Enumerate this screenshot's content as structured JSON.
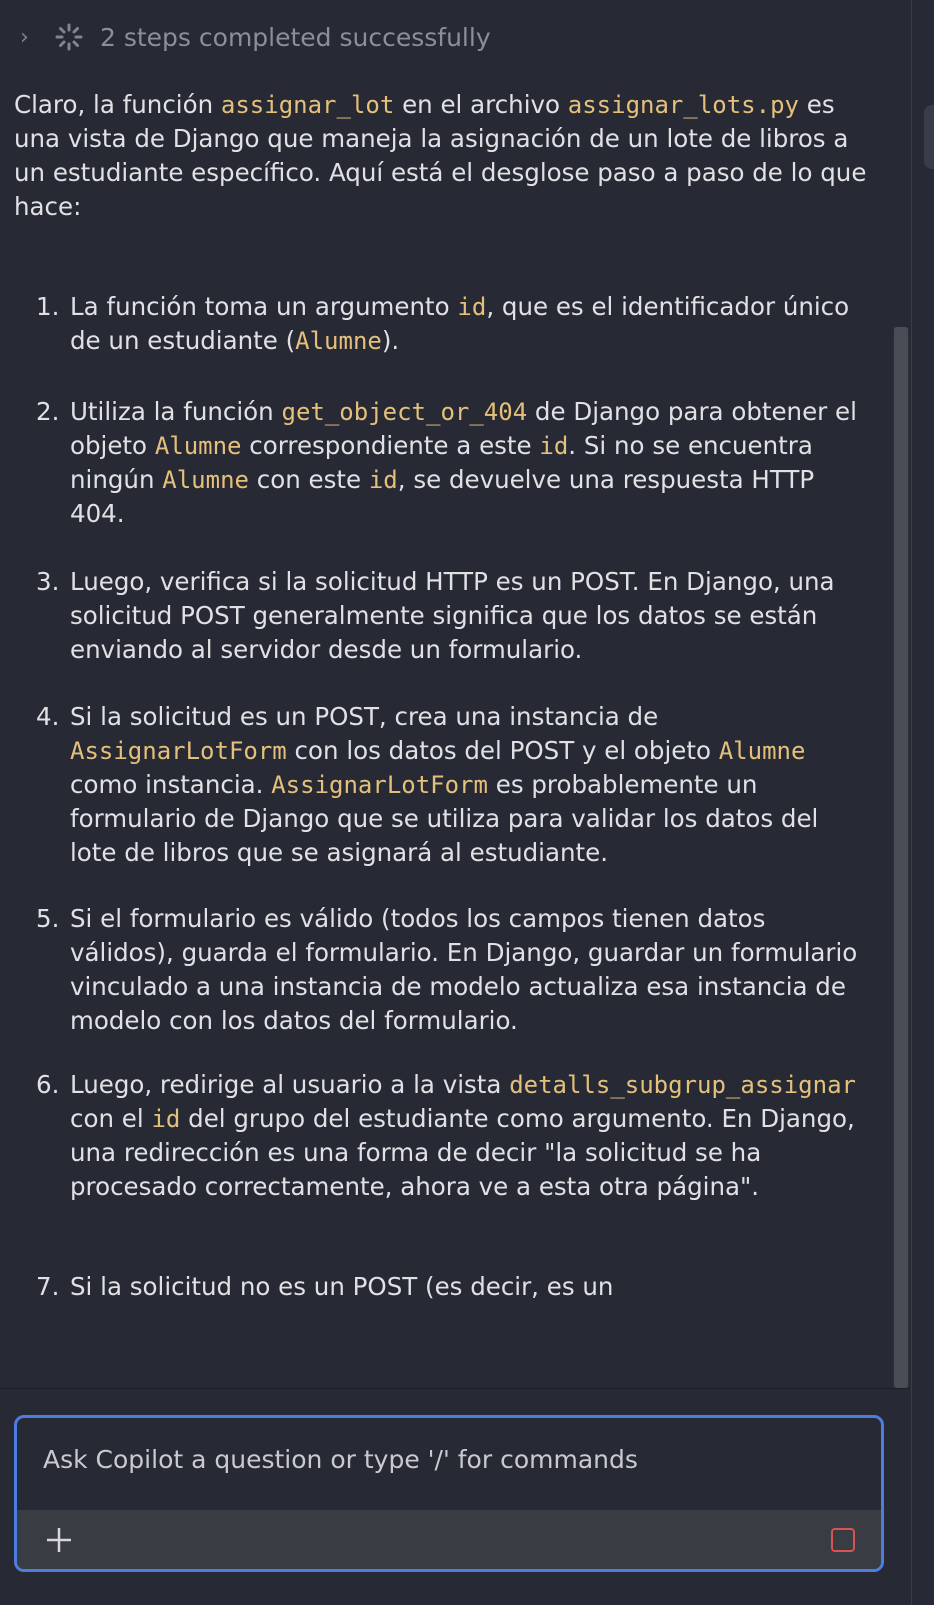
{
  "steps": {
    "summary": "2 steps completed successfully"
  },
  "intro": {
    "p1": "Claro, la función ",
    "c1": "assignar_lot",
    "p2": " en el archivo ",
    "c2": "assignar_lots.py",
    "p3": " es una vista de Django que maneja la asignación de un lote de libros a un estudiante específico. Aquí está el desglose paso a paso de lo que hace:"
  },
  "list": [
    {
      "num": "1.",
      "parts": [
        {
          "t": "La función toma un argumento "
        },
        {
          "c": "id"
        },
        {
          "t": ", que es el identificador único de un estudiante ("
        },
        {
          "c": "Alumne"
        },
        {
          "t": ")."
        }
      ]
    },
    {
      "num": "2.",
      "parts": [
        {
          "t": "Utiliza la función "
        },
        {
          "c": "get_object_or_404"
        },
        {
          "t": " de Django para obtener el objeto "
        },
        {
          "c": "Alumne"
        },
        {
          "t": " correspondiente a este "
        },
        {
          "c": "id"
        },
        {
          "t": ". Si no se encuentra ningún "
        },
        {
          "c": "Alumne"
        },
        {
          "t": " con este "
        },
        {
          "c": "id"
        },
        {
          "t": ", se devuelve una respuesta HTTP 404."
        }
      ]
    },
    {
      "num": "3.",
      "parts": [
        {
          "t": "Luego, verifica si la solicitud HTTP es un POST. En Django, una solicitud POST generalmente significa que los datos se están enviando al servidor desde un formulario."
        }
      ]
    },
    {
      "num": "4.",
      "parts": [
        {
          "t": "Si la solicitud es un POST, crea una instancia de "
        },
        {
          "c": "AssignarLotForm"
        },
        {
          "t": " con los datos del POST y el objeto "
        },
        {
          "c": "Alumne"
        },
        {
          "t": " como instancia. "
        },
        {
          "c": "AssignarLotForm"
        },
        {
          "t": " es probablemente un formulario de Django que se utiliza para validar los datos del lote de libros que se asignará al estudiante."
        }
      ]
    },
    {
      "num": "5.",
      "parts": [
        {
          "t": "Si el formulario es válido (todos los campos tienen datos válidos), guarda el formulario. En Django, guardar un formulario vinculado a una instancia de modelo actualiza esa instancia de modelo con los datos del formulario."
        }
      ]
    },
    {
      "num": "6.",
      "parts": [
        {
          "t": "Luego, redirige al usuario a la vista "
        },
        {
          "c": "detalls_subgrup_assignar"
        },
        {
          "t": " con el "
        },
        {
          "c": "id"
        },
        {
          "t": " del grupo del estudiante como argumento. En Django, una redirección es una forma de decir \"la solicitud se ha procesado correctamente, ahora ve a esta otra página\"."
        }
      ]
    },
    {
      "num": "7.",
      "parts": [
        {
          "t": "Si la solicitud no es un POST (es decir, es un"
        }
      ]
    }
  ],
  "input": {
    "placeholder": "Ask Copilot a question or type '/' for commands"
  },
  "colors": {
    "accent": "#4f7ce0",
    "code": "#e5c07b",
    "stop": "#d9534f",
    "background": "#272a34"
  }
}
